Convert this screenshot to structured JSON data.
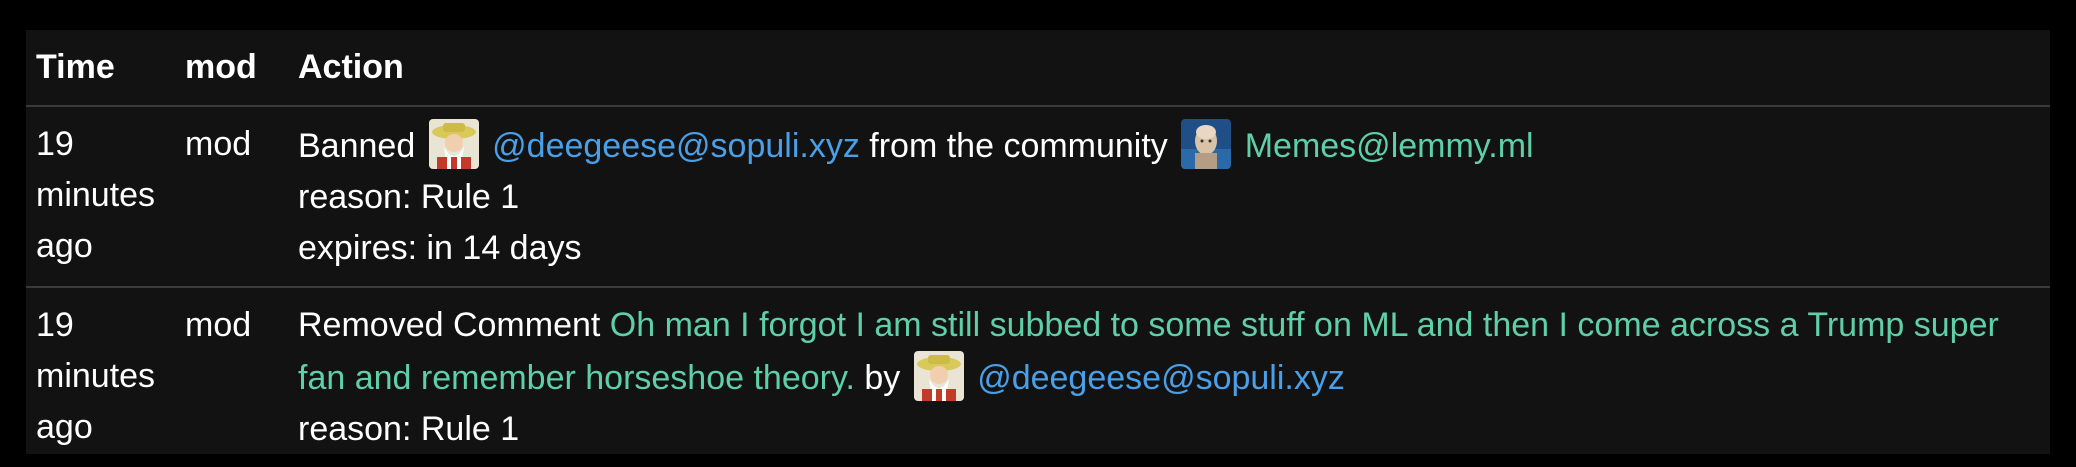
{
  "headers": {
    "time": "Time",
    "mod": "mod",
    "action": "Action"
  },
  "rows": [
    {
      "time": "19 minutes ago",
      "mod": "mod",
      "action_prefix": "Banned",
      "user": "@deegeese@sopuli.xyz",
      "middle_text": "from the community",
      "community": "Memes@lemmy.ml",
      "reason": "reason: Rule 1",
      "expires": "expires: in 14 days"
    },
    {
      "time": "19 minutes ago",
      "mod": "mod",
      "action_prefix": "Removed Comment",
      "comment": "Oh man I forgot I am still subbed to some stuff on ML and then I come across a Trump super fan and remember horseshoe theory.",
      "by_text": "by",
      "user": "@deegeese@sopuli.xyz",
      "reason": "reason: Rule 1"
    }
  ],
  "colors": {
    "background": "#000000",
    "panel": "#121212",
    "user_link": "#4a9fe6",
    "community_link": "#5fcfa8"
  },
  "icons": {
    "user_avatar": "farmer-avatar-icon",
    "community_avatar": "stonks-avatar-icon"
  }
}
